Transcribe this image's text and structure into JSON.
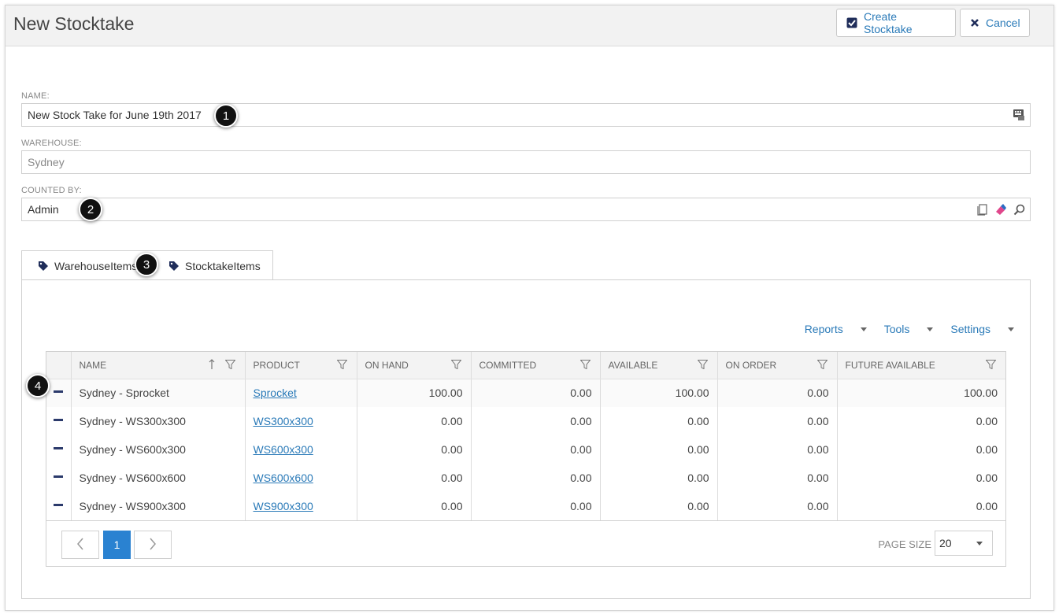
{
  "header": {
    "title": "New Stocktake",
    "create_label": "Create Stocktake",
    "cancel_label": "Cancel"
  },
  "form": {
    "name_label": "NAME:",
    "name_value": "New Stock Take for June 19th 2017",
    "warehouse_label": "WAREHOUSE:",
    "warehouse_value": "Sydney",
    "counted_by_label": "COUNTED BY:",
    "counted_by_value": "Admin"
  },
  "callouts": [
    "1",
    "2",
    "3",
    "4"
  ],
  "tabs": [
    {
      "label": "WarehouseItems"
    },
    {
      "label": "StocktakeItems"
    }
  ],
  "toolbar": {
    "reports": "Reports",
    "tools": "Tools",
    "settings": "Settings"
  },
  "grid": {
    "columns": [
      "NAME",
      "PRODUCT",
      "ON HAND",
      "COMMITTED",
      "AVAILABLE",
      "ON ORDER",
      "FUTURE AVAILABLE"
    ],
    "rows": [
      {
        "name": "Sydney - Sprocket",
        "product": "Sprocket",
        "on_hand": "100.00",
        "committed": "0.00",
        "available": "100.00",
        "on_order": "0.00",
        "future_available": "100.00"
      },
      {
        "name": "Sydney - WS300x300",
        "product": "WS300x300",
        "on_hand": "0.00",
        "committed": "0.00",
        "available": "0.00",
        "on_order": "0.00",
        "future_available": "0.00"
      },
      {
        "name": "Sydney - WS600x300",
        "product": "WS600x300",
        "on_hand": "0.00",
        "committed": "0.00",
        "available": "0.00",
        "on_order": "0.00",
        "future_available": "0.00"
      },
      {
        "name": "Sydney - WS600x600",
        "product": "WS600x600",
        "on_hand": "0.00",
        "committed": "0.00",
        "available": "0.00",
        "on_order": "0.00",
        "future_available": "0.00"
      },
      {
        "name": "Sydney - WS900x300",
        "product": "WS900x300",
        "on_hand": "0.00",
        "committed": "0.00",
        "available": "0.00",
        "on_order": "0.00",
        "future_available": "0.00"
      }
    ]
  },
  "pager": {
    "current_page": "1",
    "page_size_label": "PAGE SIZE",
    "page_size_value": "20"
  },
  "colors": {
    "accent": "#2a7ab8",
    "active_page": "#2a82d1",
    "callout": "#111111"
  },
  "icons": {
    "create": "checkbox-checked-icon",
    "cancel": "x-icon",
    "tab": "tag-icon",
    "name_field": "keyboard-lookup-icon",
    "counted_by": [
      "copy-icon",
      "eraser-icon",
      "search-icon"
    ]
  }
}
